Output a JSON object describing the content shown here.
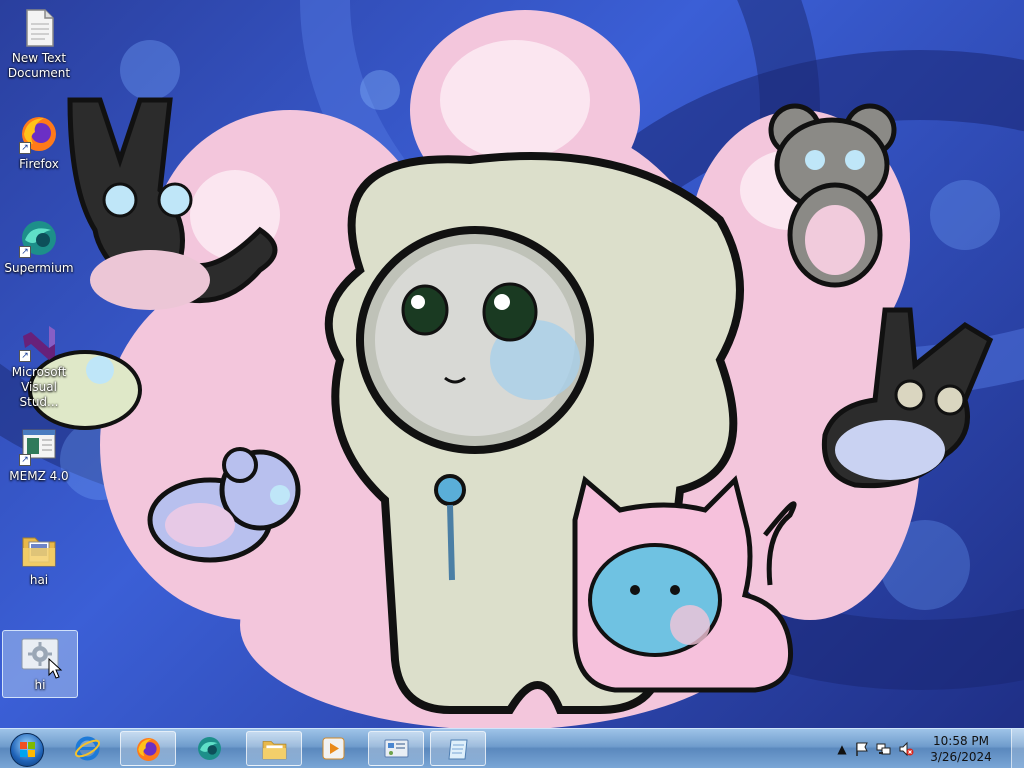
{
  "desktop": {
    "icons": [
      {
        "label": "New Text Document",
        "icon": "text-document-icon"
      },
      {
        "label": "Firefox",
        "icon": "firefox-icon"
      },
      {
        "label": "Supermium",
        "icon": "supermium-icon"
      },
      {
        "label": "Microsoft Visual Stud...",
        "icon": "visual-studio-icon"
      },
      {
        "label": "MEMZ 4.0",
        "icon": "memz-icon"
      },
      {
        "label": "hai",
        "icon": "folder-icon"
      },
      {
        "label": "hi",
        "icon": "settings-app-icon"
      }
    ]
  },
  "taskbar": {
    "pinned": [
      {
        "name": "internet-explorer",
        "icon": "internet-explorer-icon",
        "open": false
      },
      {
        "name": "firefox",
        "icon": "firefox-icon",
        "open": true
      },
      {
        "name": "supermium",
        "icon": "supermium-icon",
        "open": false
      },
      {
        "name": "file-explorer",
        "icon": "folder-icon",
        "open": true
      },
      {
        "name": "media-player",
        "icon": "media-player-icon",
        "open": false
      },
      {
        "name": "control-panel",
        "icon": "control-panel-icon",
        "open": true
      },
      {
        "name": "notepad",
        "icon": "notepad-icon",
        "open": true
      }
    ],
    "tray": {
      "icons": [
        "show-hidden-icons-icon",
        "action-center-flag-icon",
        "network-icon",
        "volume-muted-icon"
      ],
      "time": "10:58 PM",
      "date": "3/26/2024"
    }
  },
  "colors": {
    "taskbar": "#6f9ccc",
    "wallpaper_blue": "#2a3f9e",
    "wallpaper_pink": "#f3c6dc"
  }
}
